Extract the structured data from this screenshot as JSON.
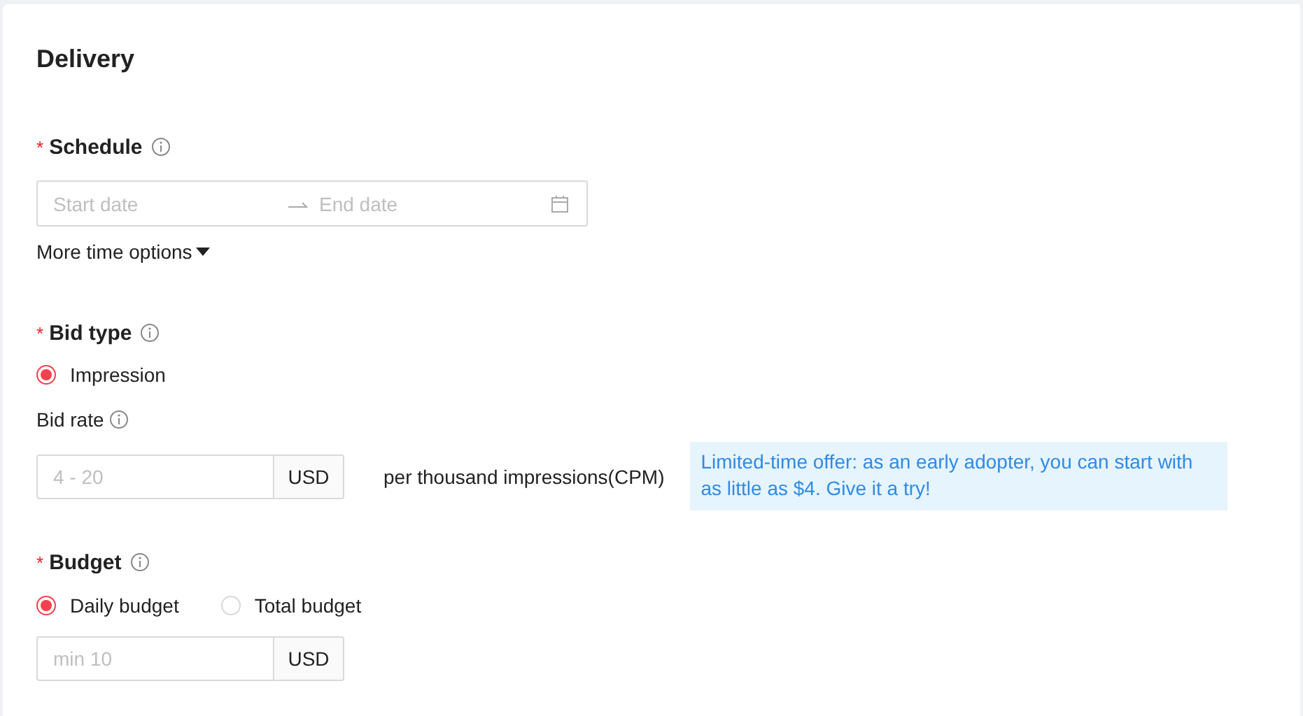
{
  "title": "Delivery",
  "schedule": {
    "required_mark": "*",
    "label": "Schedule",
    "start_placeholder": "Start date",
    "end_placeholder": "End date",
    "more_options": "More time options"
  },
  "bid_type": {
    "required_mark": "*",
    "label": "Bid type",
    "options": [
      {
        "label": "Impression",
        "selected": true
      }
    ]
  },
  "bid_rate": {
    "label": "Bid rate",
    "placeholder": "4 - 20",
    "unit": "USD",
    "suffix": "per thousand impressions(CPM)",
    "tip": "Limited-time offer: as an early adopter, you can start with as little as $4. Give it a try!"
  },
  "budget": {
    "required_mark": "*",
    "label": "Budget",
    "options": [
      {
        "label": "Daily budget",
        "selected": true
      },
      {
        "label": "Total budget",
        "selected": false
      }
    ],
    "placeholder": "min 10",
    "unit": "USD"
  }
}
